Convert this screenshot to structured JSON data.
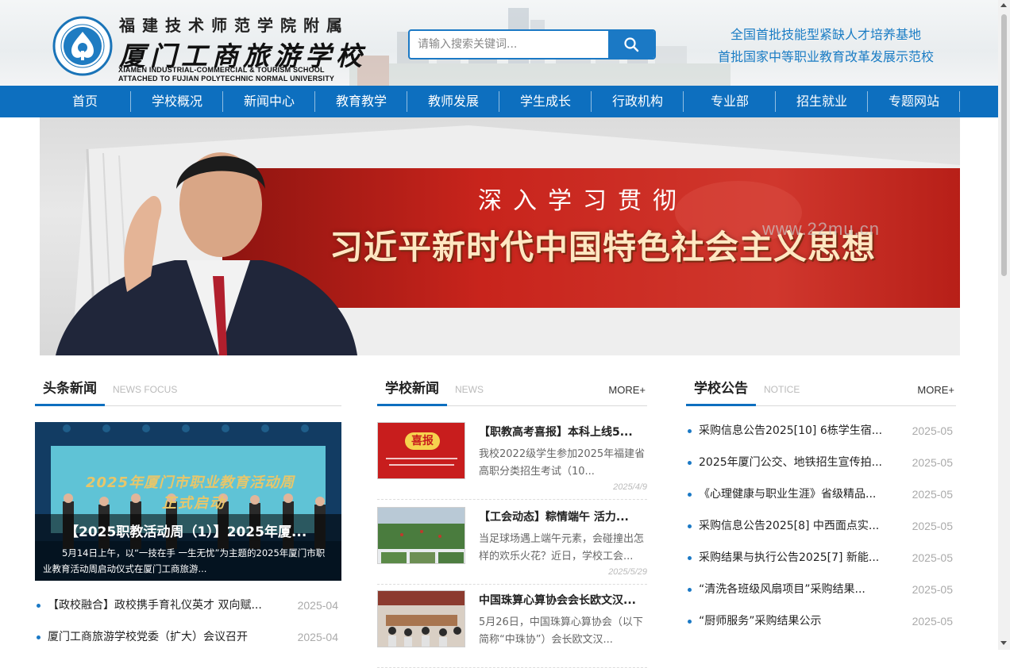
{
  "header": {
    "logo_cn_top": "福建技术师范学院附属",
    "logo_cn_main": "厦门工商旅游学校",
    "logo_en_line1": "XIAMEN INDUSTRIAL-COMMERCIAL & TOURISM SCHOOL",
    "logo_en_line2": "ATTACHED TO FUJIAN POLYTECHNIC NORMAL UNIVERSITY",
    "search_placeholder": "请输入搜索关键词...",
    "search_value": "",
    "search_icon": "search-icon",
    "slogan1": "全国首批技能型紧缺人才培养基地",
    "slogan2": "首批国家中等职业教育改革发展示范校"
  },
  "nav": {
    "items": [
      "首页",
      "学校概况",
      "新闻中心",
      "教育教学",
      "教师发展",
      "学生成长",
      "行政机构",
      "专业部",
      "招生就业",
      "专题网站"
    ]
  },
  "banner": {
    "subtitle": "深入学习贯彻",
    "title": "习近平新时代中国特色社会主义思想",
    "watermark": "www.22mu.cn"
  },
  "headline": {
    "title_cn": "头条新闻",
    "title_en": "NEWS FOCUS",
    "image_text": "2025年厦门市职业教育活动周",
    "image_text2": "正式启动",
    "caption_title": "【2025职教活动周（1）】2025年厦...",
    "caption_desc": "5月14日上午，以“一技在手 一生无忧”为主题的2025年厦门市职业教育活动周启动仪式在厦门工商旅游...",
    "list": [
      {
        "title": "【政校融合】政校携手育礼仪英才 双向赋...",
        "date": "2025-04"
      },
      {
        "title": "厦门工商旅游学校党委（扩大）会议召开",
        "date": "2025-04"
      }
    ]
  },
  "school_news": {
    "title_cn": "学校新闻",
    "title_en": "NEWS",
    "more": "MORE+",
    "items": [
      {
        "title": "【职教高考喜报】本科上线5...",
        "desc": "我校2022级学生参加2025年福建省高职分类招生考试（10...",
        "date": "2025/4/9",
        "thumb_label": "喜报"
      },
      {
        "title": "【工会动态】粽情端午 活力...",
        "desc": "当足球场遇上端午元素，会碰撞出怎样的欢乐火花？近日，学校工会...",
        "date": "2025/5/29",
        "thumb_label": ""
      },
      {
        "title": "中国珠算心算协会会长欧文汉...",
        "desc": "5月26日，中国珠算心算协会（以下简称“中珠协”）会长欧文汉...",
        "date": "",
        "thumb_label": ""
      }
    ]
  },
  "notices": {
    "title_cn": "学校公告",
    "title_en": "NOTICE",
    "more": "MORE+",
    "items": [
      {
        "title": "采购信息公告2025[10] 6栋学生宿...",
        "date": "2025-05"
      },
      {
        "title": "2025年厦门公交、地铁招生宣传拍...",
        "date": "2025-05"
      },
      {
        "title": "《心理健康与职业生涯》省级精品...",
        "date": "2025-05"
      },
      {
        "title": "采购信息公告2025[8] 中西面点实...",
        "date": "2025-05"
      },
      {
        "title": "采购结果与执行公告2025[7] 新能...",
        "date": "2025-05"
      },
      {
        "title": "“清洗各班级风扇项目”采购结果...",
        "date": "2025-05"
      },
      {
        "title": "“厨师服务”采购结果公示",
        "date": "2025-05"
      }
    ]
  },
  "colors": {
    "primary": "#0d6fbf",
    "banner_red": "#c8241c"
  }
}
